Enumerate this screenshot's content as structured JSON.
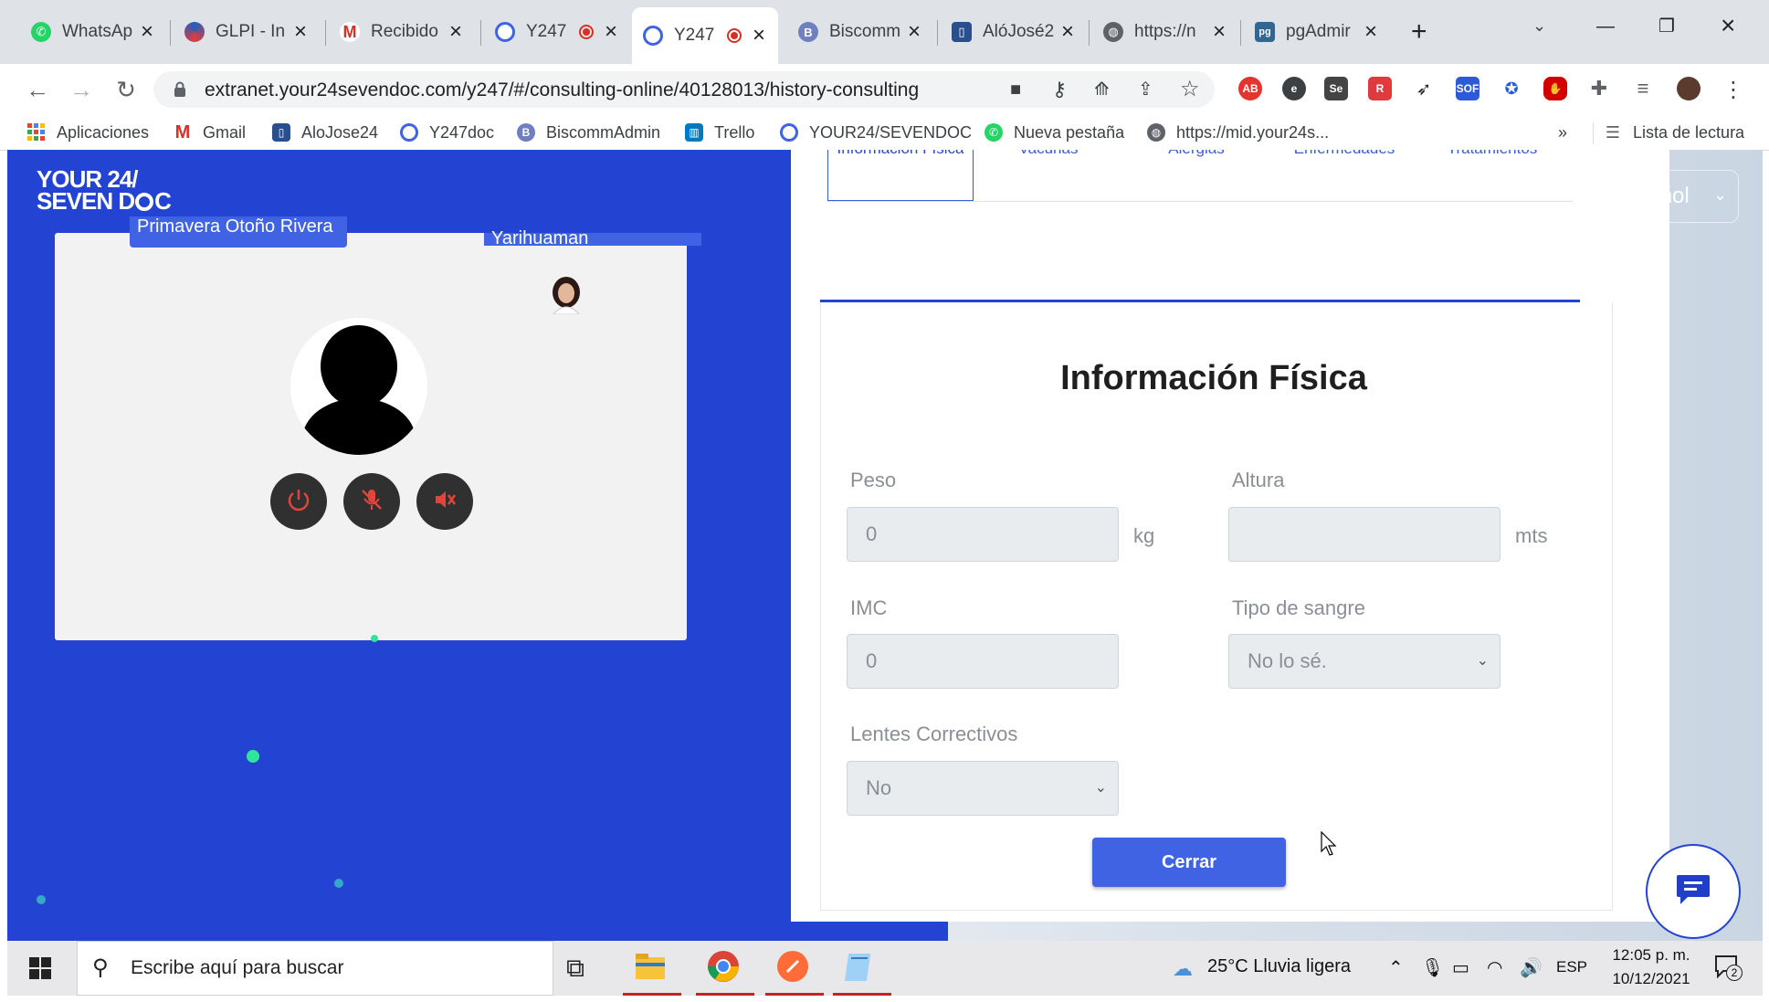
{
  "browser": {
    "tabs": [
      {
        "label": "WhatsAp",
        "icon": "whatsapp-icon"
      },
      {
        "label": "GLPI - In",
        "icon": "glpi-icon"
      },
      {
        "label": "Recibido",
        "icon": "gmail-icon"
      },
      {
        "label": "Y247",
        "icon": "y247-icon",
        "recording": true
      },
      {
        "label": "Y247",
        "icon": "y247-icon",
        "recording": true,
        "active": true
      },
      {
        "label": "Biscomm",
        "icon": "biscomm-icon"
      },
      {
        "label": "AlóJosé2",
        "icon": "alojose-icon"
      },
      {
        "label": "https://n",
        "icon": "globe-icon"
      },
      {
        "label": "pgAdmir",
        "icon": "pgadmin-icon"
      }
    ],
    "url": "extranet.your24sevendoc.com/y247/#/consulting-online/40128013/history-consulting",
    "bookmarks": [
      {
        "label": "Aplicaciones"
      },
      {
        "label": "Gmail"
      },
      {
        "label": "AloJose24"
      },
      {
        "label": "Y247doc"
      },
      {
        "label": "BiscommAdmin"
      },
      {
        "label": "Trello"
      },
      {
        "label": "YOUR24/SEVENDOC"
      },
      {
        "label": "Nueva pestaña"
      },
      {
        "label": "https://mid.your24s..."
      }
    ],
    "reading_list": "Lista de lectura",
    "overflow": "»"
  },
  "app": {
    "logo_line1": "YOUR 24/",
    "logo_line2": "SEVEN D",
    "logo_line2_end": "C",
    "language": "Español",
    "video": {
      "participant_left": "Primavera Otoño Rivera",
      "participant_right": "Yarihuaman"
    },
    "form_tabs": [
      "Información Física",
      "Vacunas",
      "Alergias",
      "Enfermedades",
      "Tratamientos"
    ],
    "form": {
      "title": "Información Física",
      "peso_label": "Peso",
      "peso_value": "0",
      "peso_unit": "kg",
      "altura_label": "Altura",
      "altura_value": "",
      "altura_unit": "mts",
      "imc_label": "IMC",
      "imc_value": "0",
      "sangre_label": "Tipo de sangre",
      "sangre_value": "No lo sé.",
      "lentes_label": "Lentes Correctivos",
      "lentes_value": "No",
      "close_button": "Cerrar"
    }
  },
  "taskbar": {
    "search_placeholder": "Escribe aquí para buscar",
    "weather": "25°C  Lluvia ligera",
    "language": "ESP",
    "time": "12:05 p. m.",
    "date": "10/12/2021",
    "notifications": "2"
  }
}
